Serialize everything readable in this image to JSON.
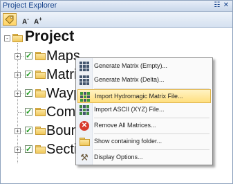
{
  "window": {
    "title": "Project Explorer",
    "pin_icon": "pin-icon",
    "close_icon": "close-icon"
  },
  "toolbar": {
    "items": [
      {
        "name": "tag-tool-button",
        "icon": "tag-icon",
        "active": true
      },
      {
        "name": "decrease-font-button",
        "label": "A",
        "sup": "-"
      },
      {
        "name": "increase-font-button",
        "label": "A",
        "sup": "+"
      }
    ]
  },
  "tree": {
    "root": {
      "label": "Project",
      "expander": "-"
    },
    "children": [
      {
        "label": "Maps",
        "checked": true,
        "expander": "+"
      },
      {
        "label": "Matri",
        "checked": true,
        "expander": "+"
      },
      {
        "label": "Wayp",
        "checked": true,
        "expander": "+"
      },
      {
        "label": "Com",
        "checked": true,
        "expander": ""
      },
      {
        "label": "Boun",
        "checked": true,
        "expander": "+"
      },
      {
        "label": "Secti",
        "checked": true,
        "expander": "+"
      }
    ]
  },
  "context_menu": {
    "items": [
      {
        "label": "Generate Matrix (Empty)...",
        "icon": "matrix-grid-icon"
      },
      {
        "label": "Generate Matrix (Delta)...",
        "icon": "matrix-grid-icon"
      },
      {
        "label": "Import Hydromagic Matrix File...",
        "icon": "matrix-import-icon",
        "highlighted": true
      },
      {
        "label": "Import ASCII (XYZ) File...",
        "icon": "ascii-import-icon"
      },
      {
        "label": "Remove All Matrices...",
        "icon": "remove-icon"
      },
      {
        "label": "Show containing folder...",
        "icon": "folder-icon"
      },
      {
        "label": "Display Options...",
        "icon": "tools-icon"
      }
    ]
  }
}
